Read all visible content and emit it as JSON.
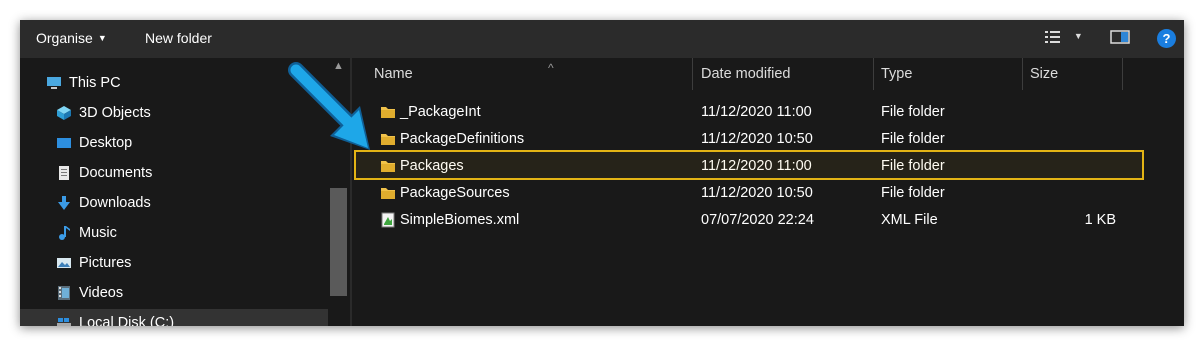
{
  "toolbar": {
    "organise_label": "Organise",
    "new_folder_label": "New folder"
  },
  "sidebar": {
    "items": [
      {
        "label": "This PC",
        "icon": "computer-icon"
      },
      {
        "label": "3D Objects",
        "icon": "cube-icon"
      },
      {
        "label": "Desktop",
        "icon": "desktop-icon"
      },
      {
        "label": "Documents",
        "icon": "document-icon"
      },
      {
        "label": "Downloads",
        "icon": "download-icon"
      },
      {
        "label": "Music",
        "icon": "music-icon"
      },
      {
        "label": "Pictures",
        "icon": "picture-icon"
      },
      {
        "label": "Videos",
        "icon": "video-icon"
      },
      {
        "label": "Local Disk (C:)",
        "icon": "drive-icon"
      }
    ]
  },
  "columns": {
    "name": "Name",
    "date_modified": "Date modified",
    "type": "Type",
    "size": "Size"
  },
  "files": [
    {
      "name": "_PackageInt",
      "date": "11/12/2020 11:00",
      "type": "File folder",
      "size": "",
      "icon": "folder-icon"
    },
    {
      "name": "PackageDefinitions",
      "date": "11/12/2020 10:50",
      "type": "File folder",
      "size": "",
      "icon": "folder-icon"
    },
    {
      "name": "Packages",
      "date": "11/12/2020 11:00",
      "type": "File folder",
      "size": "",
      "icon": "folder-icon"
    },
    {
      "name": "PackageSources",
      "date": "11/12/2020 10:50",
      "type": "File folder",
      "size": "",
      "icon": "folder-icon"
    },
    {
      "name": "SimpleBiomes.xml",
      "date": "07/07/2020 22:24",
      "type": "XML File",
      "size": "1 KB",
      "icon": "xml-file-icon"
    }
  ],
  "colors": {
    "window_bg": "#191919",
    "toolbar_bg": "#2b2b2b",
    "highlight_border": "#e3b415",
    "annotation_arrow": "#1ea7e8",
    "folder": "#f0c24b"
  }
}
